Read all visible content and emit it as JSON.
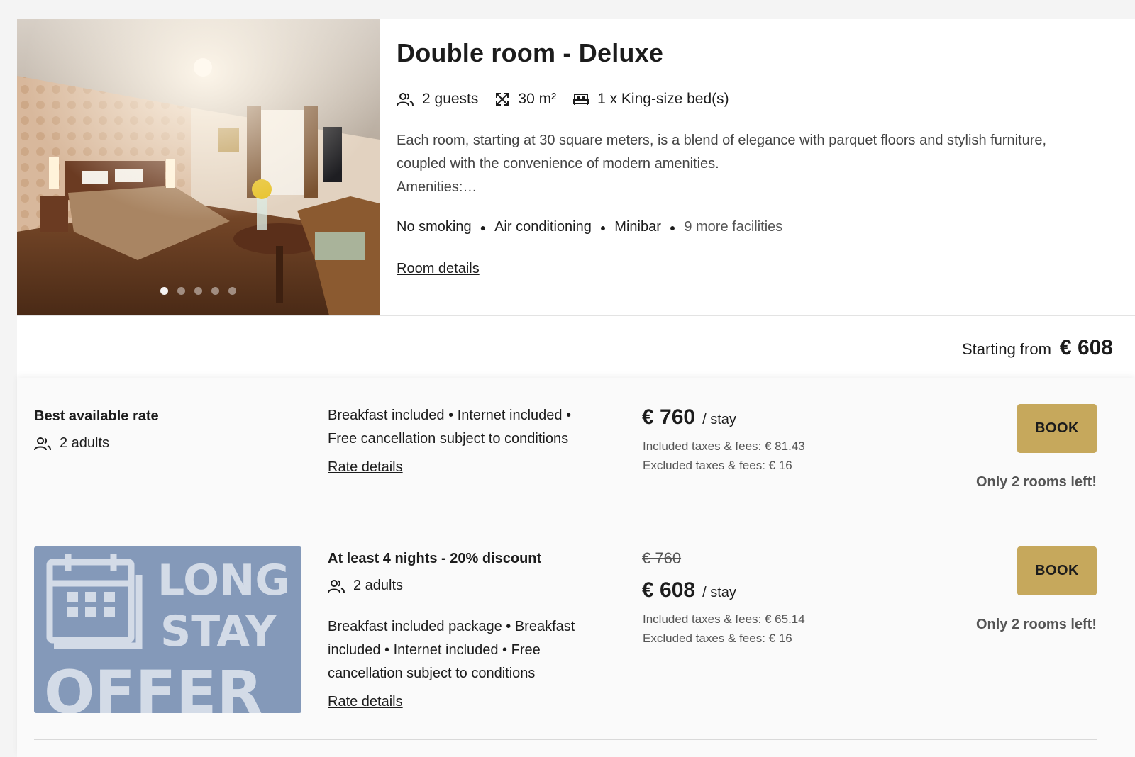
{
  "room": {
    "title": "Double room - Deluxe",
    "specs": {
      "guests": "2 guests",
      "size": "30 m²",
      "beds": "1 x King-size bed(s)"
    },
    "description_line1": "Each room, starting at 30 square meters, is a blend of elegance with parquet floors and stylish furniture,",
    "description_line2": "coupled with the convenience of modern amenities.",
    "description_line3": "Amenities:…",
    "facilities": [
      "No smoking",
      "Air conditioning",
      "Minibar"
    ],
    "more_facilities": "9 more facilities",
    "details_link": "Room details",
    "photo_dots": 5,
    "starting_from_label": "Starting from",
    "starting_from_value": "€ 608"
  },
  "rates": [
    {
      "name": "Best available rate",
      "guests": "2 adults",
      "inclusions_line1": "Breakfast included • Internet included •",
      "inclusions_line2": "Free cancellation subject to conditions",
      "details_link": "Rate details",
      "price": "€ 760",
      "per": "/ stay",
      "included_taxes": "Included taxes & fees: € 81.43",
      "excluded_taxes": "Excluded taxes & fees: € 16",
      "book_label": "BOOK",
      "availability": "Only 2 rooms left!"
    },
    {
      "name": "At least 4 nights - 20% discount",
      "guests": "2 adults",
      "inclusions_line1": "Breakfast included package • Breakfast",
      "inclusions_line2": "included • Internet included • Free",
      "inclusions_line3": "cancellation subject to conditions",
      "details_link": "Rate details",
      "old_price": "€ 760",
      "price": "€ 608",
      "per": "/ stay",
      "included_taxes": "Included taxes & fees: € 65.14",
      "excluded_taxes": "Excluded taxes & fees: € 16",
      "book_label": "BOOK",
      "availability": "Only 2 rooms left!",
      "offer_image_text": [
        "LONG",
        "STAY",
        "OFFER"
      ]
    }
  ],
  "colors": {
    "book_button": "#c6a85c",
    "offer_image_bg": "#8499b9",
    "offer_image_fg": "#d3dbe7"
  }
}
